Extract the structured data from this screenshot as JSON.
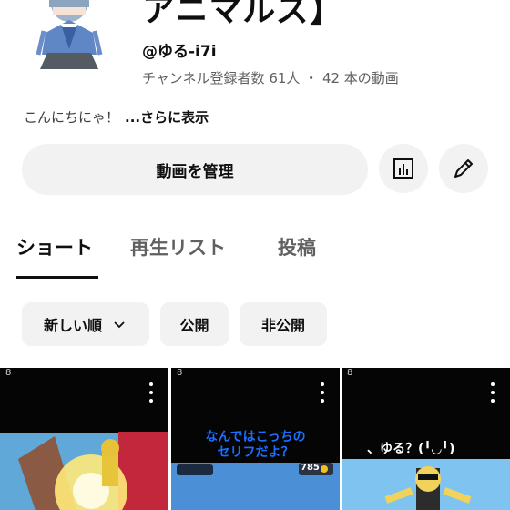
{
  "channel": {
    "name": "アニマルズ】",
    "handle": "@ゆる-i7i",
    "stats": "チャンネル登録者数 61人 ・ 42 本の動画",
    "description": "こんにちにゃ！",
    "more_link": "...さらに表示"
  },
  "actions": {
    "manage_label": "動画を管理",
    "analytics_icon": "bar-chart-icon",
    "edit_icon": "pencil-icon"
  },
  "tabs": [
    {
      "label": "ショート",
      "active": true
    },
    {
      "label": "再生リスト",
      "active": false
    },
    {
      "label": "投稿",
      "active": false
    }
  ],
  "filters": [
    {
      "label": "新しい順",
      "has_dropdown": true
    },
    {
      "label": "公開"
    },
    {
      "label": "非公開"
    }
  ],
  "videos": [
    {
      "overlay_text": ""
    },
    {
      "overlay_text_line1": "なんではこっちの",
      "overlay_text_line2": "セリフだよ？",
      "coin_count": "785"
    },
    {
      "overlay_text": "、ゆる？(╹◡╹)"
    }
  ],
  "colors": {
    "chip_bg": "#f2f2f2",
    "secondary_text": "#606060",
    "caption_blue": "#1b6fff"
  }
}
